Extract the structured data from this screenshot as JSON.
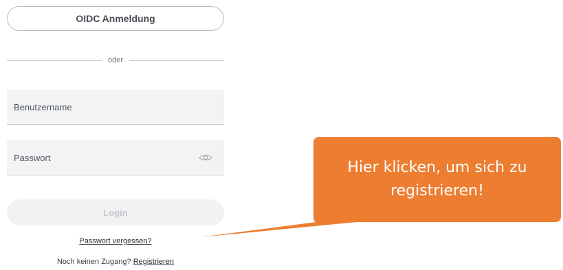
{
  "oidc": {
    "label": "OIDC Anmeldung"
  },
  "divider": {
    "label": "oder"
  },
  "username": {
    "placeholder": "Benutzername"
  },
  "password": {
    "placeholder": "Passwort",
    "toggle_icon": "eye-icon"
  },
  "login": {
    "label": "Login"
  },
  "forgot": {
    "label": "Passwort vergessen?"
  },
  "register": {
    "prompt": "Noch keinen Zugang?",
    "link": "Registrieren"
  },
  "callout": {
    "text": "Hier klicken, um sich zu registrieren!",
    "color": "#ED7D31"
  }
}
